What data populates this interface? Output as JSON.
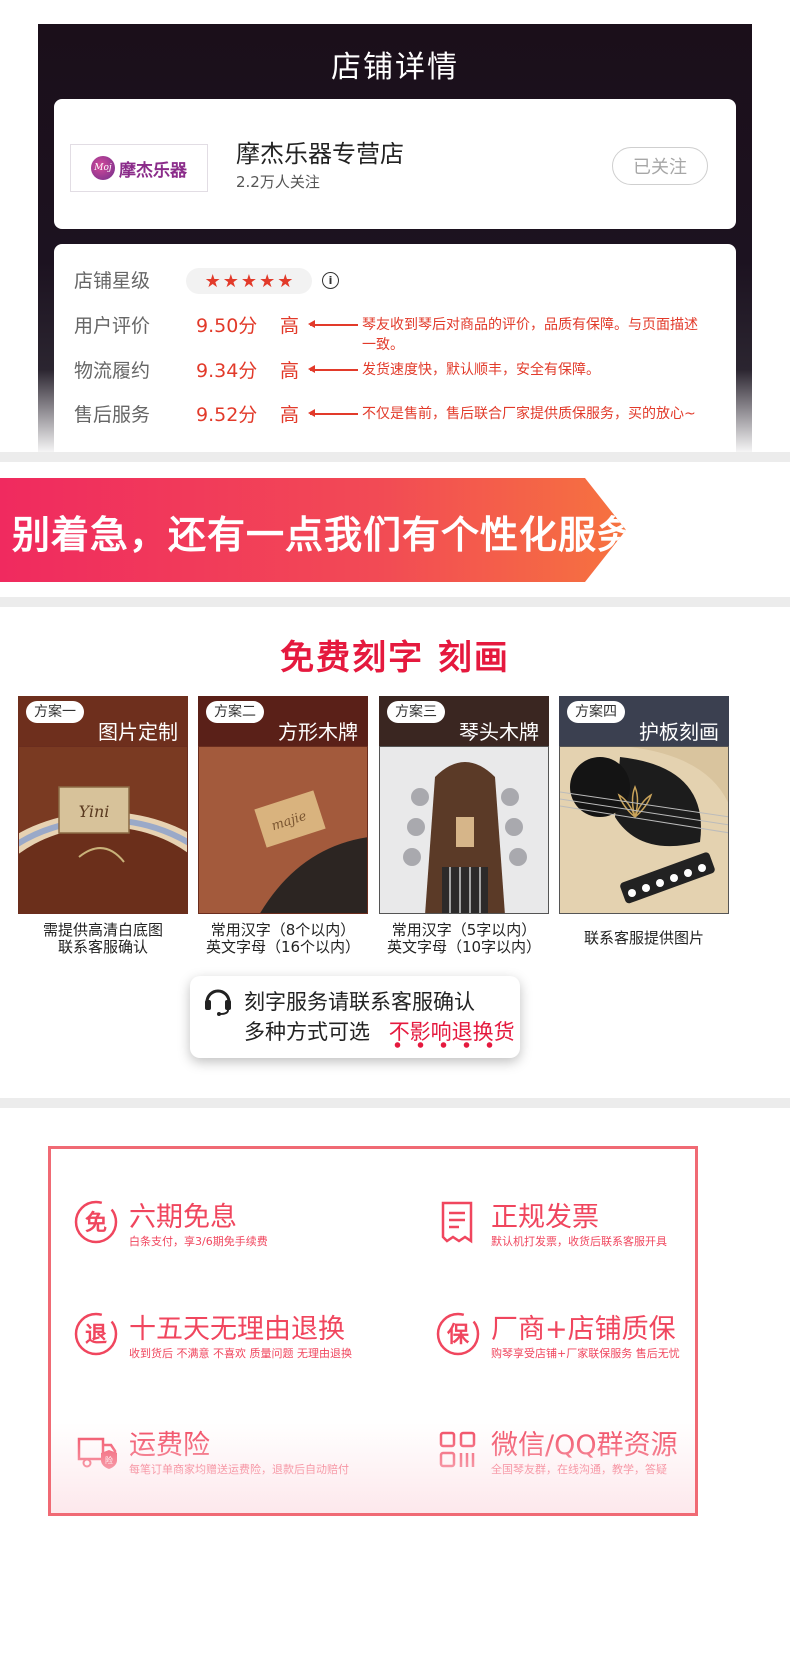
{
  "store": {
    "section_title": "店铺详情",
    "name": "摩杰乐器专营店",
    "fans": "2.2万人关注",
    "follow_label": "已关注",
    "logo_text": "摩杰乐器",
    "logo_mark": "Moj"
  },
  "ratings": {
    "star_label": "店铺星级",
    "info_symbol": "i",
    "rows": [
      {
        "label": "用户评价",
        "score": "9.50分",
        "level": "高",
        "note": "琴友收到琴后对商品的评价，品质有保障。与页面描述一致。"
      },
      {
        "label": "物流履约",
        "score": "9.34分",
        "level": "高",
        "note": "发货速度快，默认顺丰，安全有保障。"
      },
      {
        "label": "售后服务",
        "score": "9.52分",
        "level": "高",
        "note": "不仅是售前，售后联合厂家提供质保服务，买的放心~"
      }
    ]
  },
  "banner": {
    "text": "别着急，还有一点我们有个性化服务！"
  },
  "engraving": {
    "title": "免费刻字 刻画",
    "plans": [
      {
        "badge": "方案一",
        "name": "图片定制",
        "cap1": "需提供高清白底图",
        "cap2": "联系客服确认"
      },
      {
        "badge": "方案二",
        "name": "方形木牌",
        "cap1": "常用汉字（8个以内）",
        "cap2": "英文字母（16个以内）"
      },
      {
        "badge": "方案三",
        "name": "琴头木牌",
        "cap1": "常用汉字（5字以内）",
        "cap2": "英文字母（10字以内）"
      },
      {
        "badge": "方案四",
        "name": "护板刻画",
        "cap1": "联系客服提供图片",
        "cap2": ""
      }
    ],
    "cs_line1": "刻字服务请联系客服确认",
    "cs_line2_prefix": "多种方式可选",
    "cs_line2_highlight": "不影响退换货"
  },
  "guarantees": {
    "accent": "#f0465e",
    "items": [
      {
        "icon": "interest-free-icon",
        "glyph": "免",
        "title": "六期免息",
        "sub": "白条支付，享3/6期免手续费"
      },
      {
        "icon": "invoice-icon",
        "glyph": "",
        "title": "正规发票",
        "sub": "默认机打发票，收货后联系客服开具"
      },
      {
        "icon": "return-icon",
        "glyph": "退",
        "title": "十五天无理由退换",
        "sub": "收到货后 不满意  不喜欢  质量问题  无理由退换"
      },
      {
        "icon": "warranty-icon",
        "glyph": "保",
        "title": "厂商+店铺质保",
        "sub": "购琴享受店铺+厂家联保服务   售后无忧"
      },
      {
        "icon": "shipping-insurance-icon",
        "glyph": "险",
        "title": "运费险",
        "sub": "每笔订单商家均赠送运费险，退款后自动赔付"
      },
      {
        "icon": "qq-group-icon",
        "glyph": "",
        "title": "微信/QQ群资源",
        "sub": "全国琴友群，在线沟通，教学，答疑"
      }
    ]
  }
}
